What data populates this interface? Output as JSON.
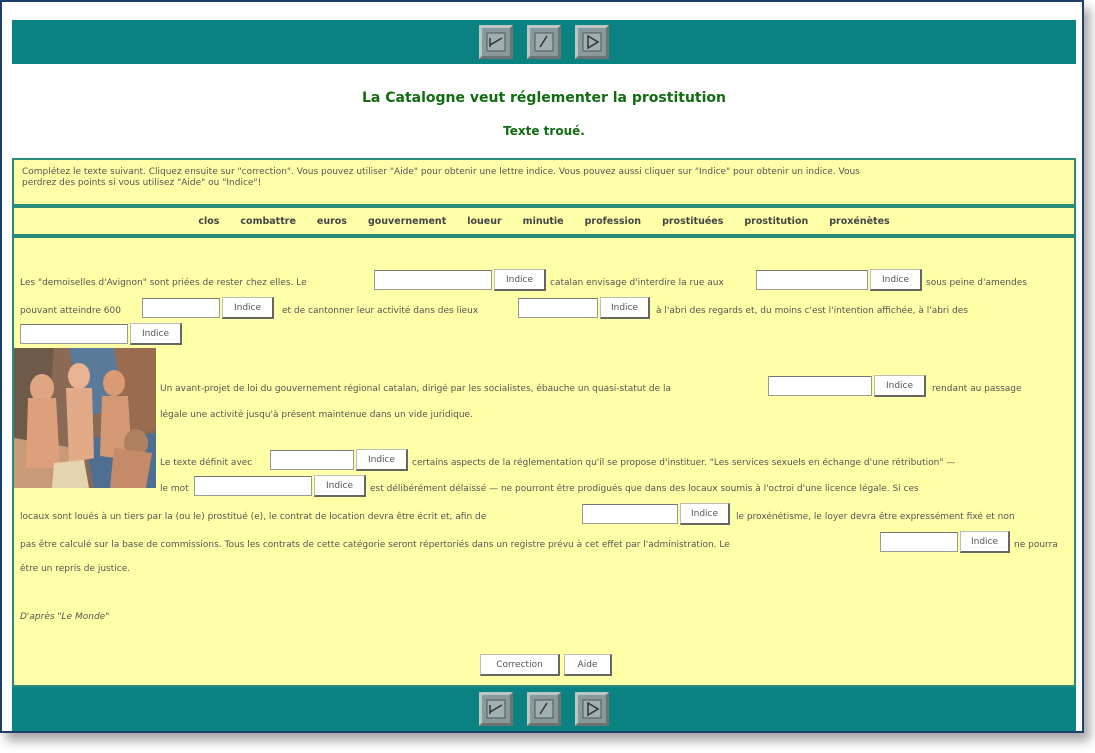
{
  "nav": {
    "top": [
      {
        "icon": "first-page-icon"
      },
      {
        "icon": "previous-page-icon"
      },
      {
        "icon": "next-page-icon"
      }
    ],
    "bottom": [
      {
        "icon": "first-page-icon"
      },
      {
        "icon": "previous-page-icon"
      },
      {
        "icon": "next-page-icon"
      }
    ]
  },
  "header": {
    "title": "La Catalogne veut réglementer la prostitution",
    "subtitle": "Texte troué."
  },
  "instructions": {
    "line1": "Complétez le texte suivant. Cliquez ensuite sur \"correction\". Vous pouvez utiliser \"Aide\" pour obtenir une lettre indice. Vous pouvez aussi cliquer sur \"Indice\" pour obtenir un indice. Vous",
    "line2": "perdrez des points si vous utilisez \"Aide\" ou \"Indice\"!"
  },
  "wordbank": [
    "clos",
    "combattre",
    "euros",
    "gouvernement",
    "loueur",
    "minutie",
    "profession",
    "prostituées",
    "prostitution",
    "proxénètes"
  ],
  "text": {
    "p1_a": "Les \"demoiselles d'Avignon\" sont priées de rester chez elles. Le",
    "p1_b": "catalan envisage d'interdire la rue aux",
    "p1_c": "sous peine d'amendes",
    "p1_d": "pouvant atteindre 600",
    "p1_e": "et de cantonner leur activité dans des lieux",
    "p1_f": "à l'abri des regards et, du moins c'est l'intention affichée, à l'abri des",
    "p2_a": "Un avant-projet de loi du gouvernement régional catalan, dirigé par les socialistes, ébauche un quasi-statut de la",
    "p2_b": "rendant au passage",
    "p2_c": "légale une activité jusqu'à présent maintenue dans un vide juridique.",
    "p3_a": "Le texte définit avec",
    "p3_b": "certains aspects de la réglementation qu'il se propose d'instituer. \"Les services sexuels en échange d'une rétribution\" —",
    "p3_c": "le mot",
    "p3_d": "est délibérément délaissé — ne pourront être prodigués que dans des locaux soumis à l'octroi d'une licence légale. Si ces",
    "p3_e": "locaux sont loués à un tiers par la (ou le) prostitué (e), le contrat de location devra être écrit et, afin de",
    "p3_f": "le proxénétisme, le loyer devra être expressément fixé et non",
    "p3_g": "pas être calculé sur la base de commissions. Tous les contrats de cette catégorie seront répertoriés dans un registre prévu à cet effet par l'administration. Le",
    "p3_h": "ne pourra",
    "p3_i": "être un repris de justice.",
    "source": "D'après \"Le Monde\""
  },
  "hint_label": "Indice",
  "buttons": {
    "correction": "Correction",
    "aide": "Aide"
  },
  "colors": {
    "nav_bar": "#0b8282",
    "panel_bg": "#ffffa8",
    "panel_border": "#2b8b7a",
    "title": "#106c10"
  },
  "painting": {
    "icon": "les-demoiselles-d-avignon-painting"
  }
}
